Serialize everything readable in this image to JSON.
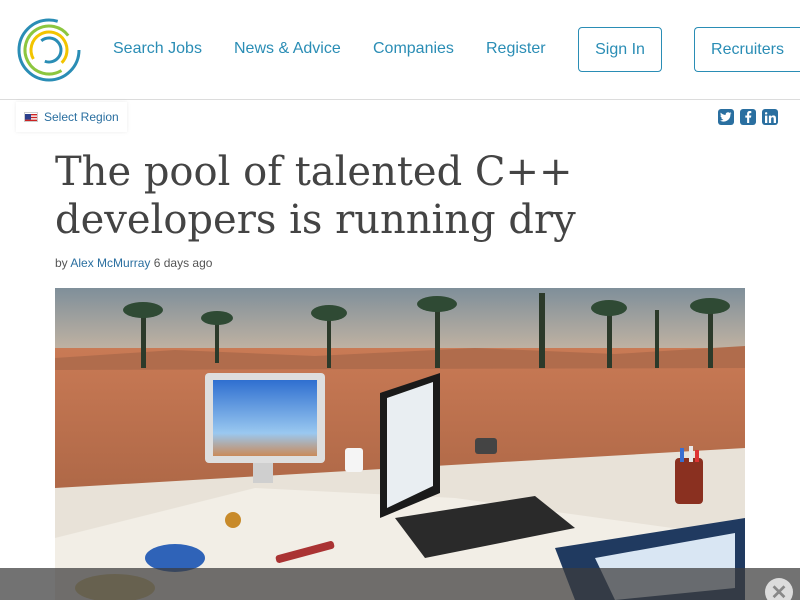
{
  "header": {
    "nav": {
      "search_jobs": "Search Jobs",
      "news_advice": "News & Advice",
      "companies": "Companies",
      "register": "Register"
    },
    "sign_in": "Sign In",
    "recruiters": "Recruiters"
  },
  "region": {
    "label": "Select Region",
    "flag_icon": "us-flag-icon"
  },
  "social": [
    "twitter-icon",
    "facebook-icon",
    "linkedin-icon"
  ],
  "article": {
    "title": "The pool of talented C++ developers is running dry",
    "by": "by",
    "author": "Alex McMurray",
    "time": "6 days ago"
  },
  "colors": {
    "accent": "#2a8db5",
    "link": "#2a6fa0",
    "title": "#444444"
  }
}
